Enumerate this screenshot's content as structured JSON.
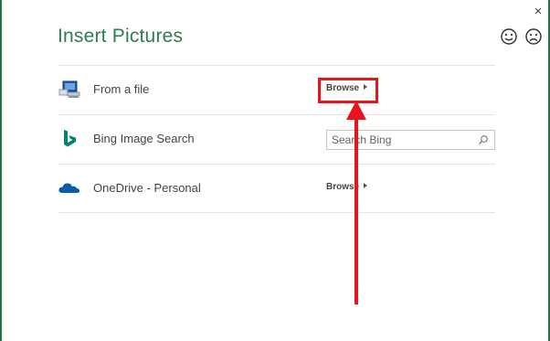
{
  "dialog": {
    "title": "Insert Pictures",
    "close_label": "×"
  },
  "feedback": {
    "smile_icon": "smiley-face-icon",
    "frown_icon": "frowning-face-icon"
  },
  "sources": [
    {
      "label": "From a file",
      "icon": "computer-icon",
      "action": "Browse"
    },
    {
      "label": "Bing Image Search",
      "icon": "bing-icon",
      "search_placeholder": "Search Bing"
    },
    {
      "label": "OneDrive - Personal",
      "icon": "onedrive-cloud-icon",
      "action": "Browse"
    }
  ],
  "annotation": {
    "highlight_color": "#e8141c"
  },
  "colors": {
    "title": "#2e7d4f",
    "window_border": "#217346",
    "bing": "#008373",
    "onedrive": "#0a5ba8"
  }
}
